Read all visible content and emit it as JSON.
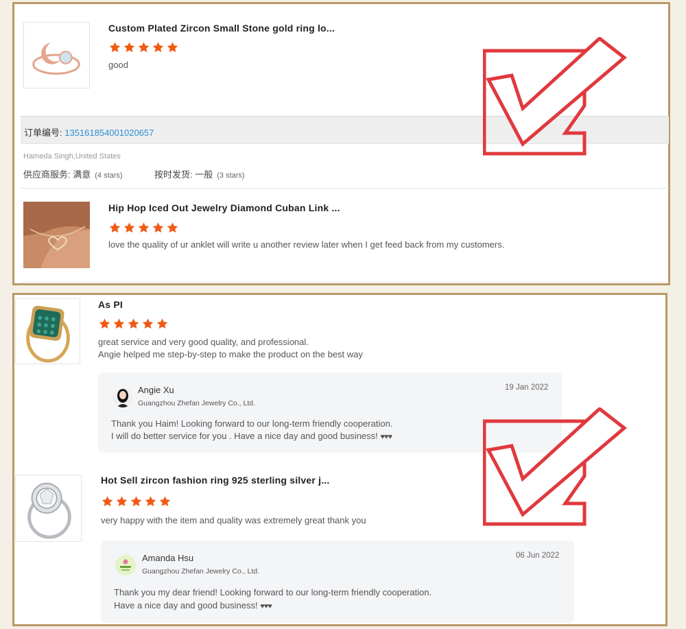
{
  "panel1": {
    "review1": {
      "title": "Custom Plated Zircon Small Stone gold ring lo...",
      "rating": 5,
      "text": "good"
    },
    "order": {
      "label": "订单编号: ",
      "number": "135161854001020657"
    },
    "buyer": "Hameda Singh,United States",
    "supplier_service": {
      "label": "供应商服务: ",
      "value": "满意",
      "stars": "(4 stars)"
    },
    "shipping": {
      "label": "按时发货: ",
      "value": "一般",
      "stars": "(3 stars)"
    },
    "review2": {
      "title": "Hip Hop Iced Out Jewelry Diamond Cuban Link ...",
      "rating": 5,
      "text": "love the quality of ur anklet will write u another review later when I get feed back from my customers."
    }
  },
  "panel2": {
    "review1": {
      "title": "As PI",
      "rating": 5,
      "text_line1": "great service and very good quality, and professional.",
      "text_line2": "Angie helped me step-by-step to make the product on the best way",
      "reply": {
        "name": "Angie Xu",
        "company": "Guangzhou Zhefan Jewelry Co., Ltd.",
        "date": "19 Jan 2022",
        "line1": "Thank you Haim! Looking forward to our long-term friendly cooperation.",
        "line2": "I will do better service for you . Have a nice day and good business! ",
        "hearts": "♥♥♥"
      }
    },
    "review2": {
      "title": "Hot Sell zircon fashion ring 925 sterling silver j...",
      "rating": 5,
      "text": "very happy with the item and quality was extremely great thank you",
      "reply": {
        "name": "Amanda Hsu",
        "company": "Guangzhou Zhefan Jewelry Co., Ltd.",
        "date": "06 Jun 2022",
        "line1": "Thank you my dear friend! Looking forward to our long-term friendly cooperation.",
        "line2": "Have a nice day and good business! ",
        "hearts": "♥♥♥"
      }
    }
  },
  "colors": {
    "frame": "#b89968",
    "star": "#f05a14",
    "check": "#e0393e",
    "link": "#2b8fd1"
  },
  "icons": [
    "star-icon",
    "checkmark-icon",
    "avatar-icon"
  ]
}
